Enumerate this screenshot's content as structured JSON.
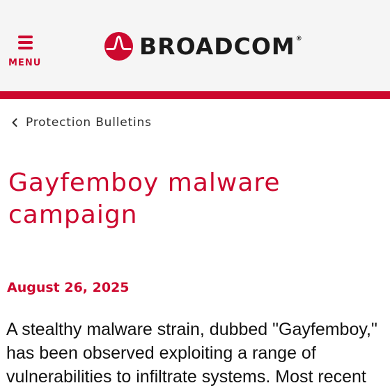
{
  "header": {
    "menu_label": "MENU",
    "brand_name": "BROADCOM",
    "brand_reg": "®",
    "brand_color": "#cc092f"
  },
  "breadcrumb": {
    "label": "Protection Bulletins",
    "icon": "chevron-left-icon"
  },
  "article": {
    "title_line1": "Gayfemboy malware",
    "title_line2": "campaign",
    "date": "August 26, 2025",
    "body_lines": [
      "A stealthy malware strain, dubbed \"Gayfemboy,\"",
      "has been observed exploiting a range of",
      "vulnerabilities to infiltrate systems. Most recent"
    ]
  },
  "colors": {
    "accent": "#cc092f",
    "header_bg": "#f5f5f5",
    "text": "#111111"
  }
}
